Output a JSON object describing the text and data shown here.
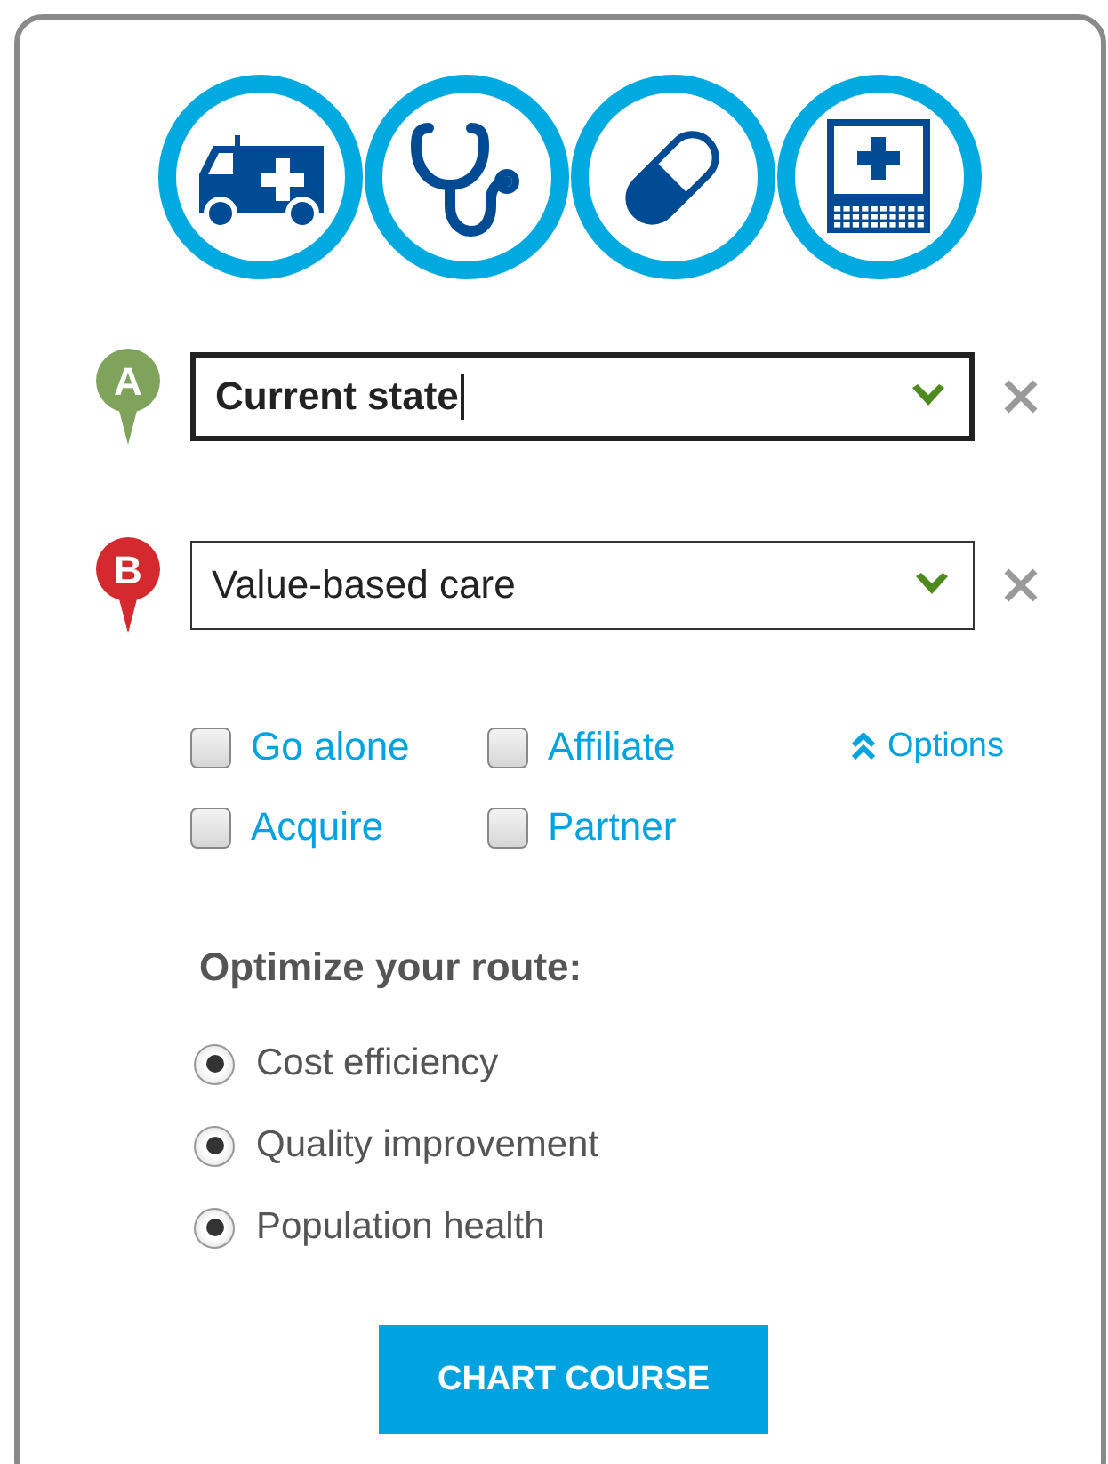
{
  "waypoints": [
    {
      "marker": "A",
      "color": "#7fa35a",
      "value": "Current state",
      "focused": true
    },
    {
      "marker": "B",
      "color": "#d42a2f",
      "value": "Value-based care",
      "focused": false
    }
  ],
  "strategies": [
    {
      "label": "Go alone",
      "checked": false
    },
    {
      "label": "Affiliate",
      "checked": false
    },
    {
      "label": "Acquire",
      "checked": false
    },
    {
      "label": "Partner",
      "checked": false
    }
  ],
  "options_link": {
    "label": "Options",
    "expanded": true
  },
  "optimize": {
    "heading": "Optimize your route:",
    "choices": [
      {
        "label": "Cost efficiency",
        "selected": true
      },
      {
        "label": "Quality improvement",
        "selected": true
      },
      {
        "label": "Population health",
        "selected": true
      }
    ]
  },
  "submit_button": "CHART COURSE"
}
